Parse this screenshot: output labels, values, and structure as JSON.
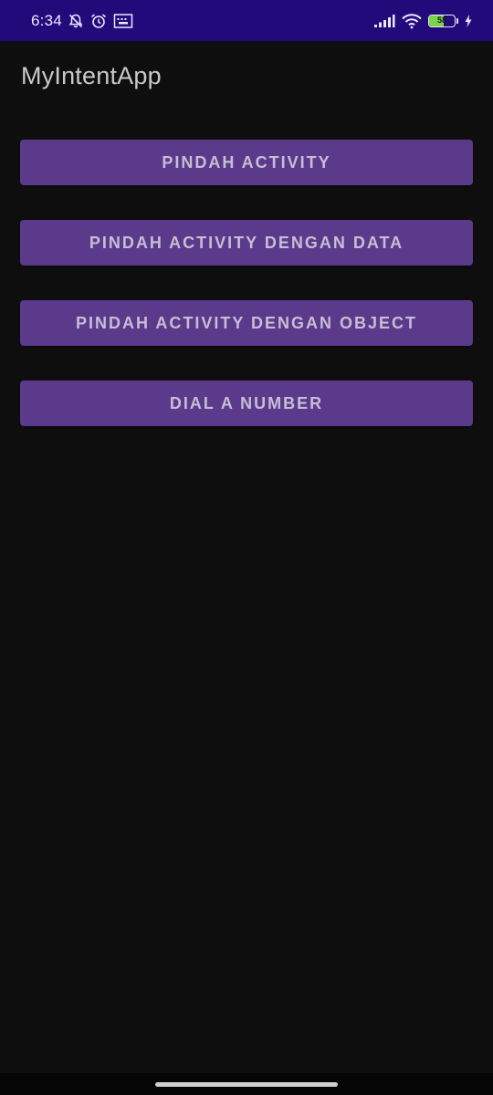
{
  "status_bar": {
    "time": "6:34",
    "battery_level": "58",
    "battery_fraction": 0.58,
    "background_color": "#220a7a",
    "icons": [
      "muted-bell-icon",
      "alarm-icon",
      "keyboard-icon",
      "signal-icon",
      "wifi-icon",
      "battery-icon",
      "charging-icon"
    ]
  },
  "app_bar": {
    "title": "MyIntentApp"
  },
  "buttons": [
    {
      "label": "PINDAH ACTIVITY"
    },
    {
      "label": "PINDAH ACTIVITY DENGAN DATA"
    },
    {
      "label": "PINDAH ACTIVITY DENGAN OBJECT"
    },
    {
      "label": "DIAL A NUMBER"
    }
  ],
  "colors": {
    "button_background": "#5b3a8c",
    "screen_background": "#0e0e0e",
    "battery_fill": "#7bd34a"
  }
}
